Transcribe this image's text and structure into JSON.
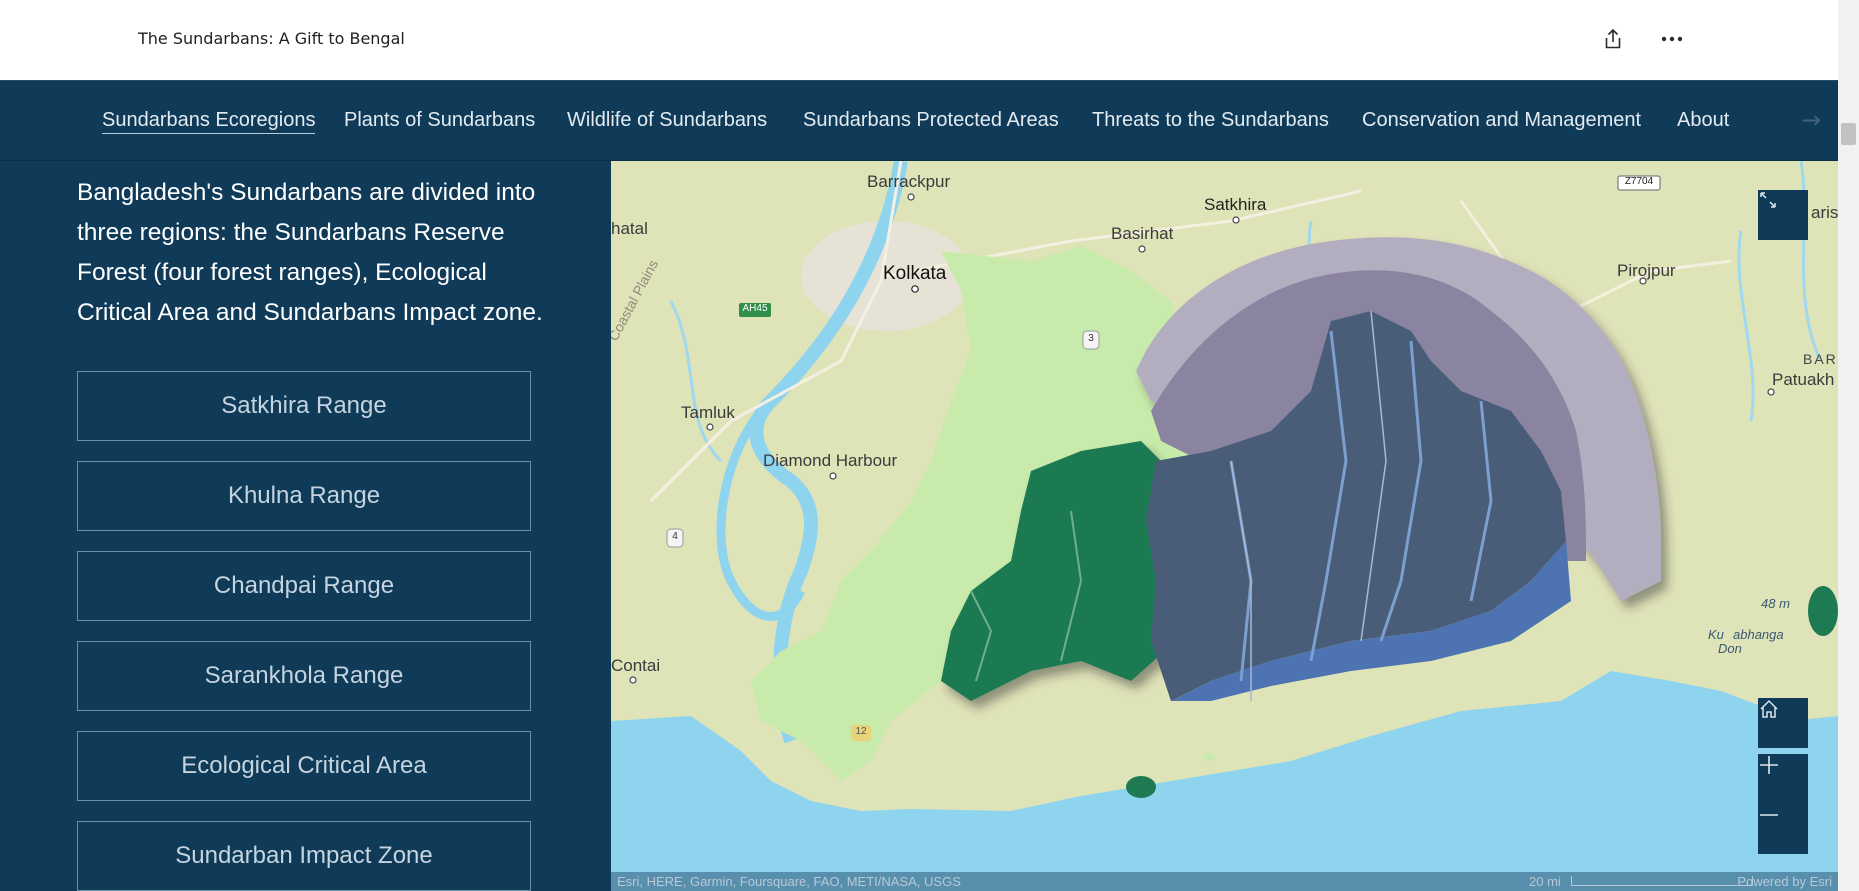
{
  "header": {
    "title": "The Sundarbans: A Gift to Bengal",
    "share_icon": "share-icon",
    "more_icon": "more-icon"
  },
  "nav": {
    "items": [
      {
        "label": "Sundarbans Ecoregions",
        "active": true
      },
      {
        "label": "Plants of Sundarbans"
      },
      {
        "label": "Wildlife of Sundarbans"
      },
      {
        "label": "Sundarbans Protected Areas"
      },
      {
        "label": "Threats to the Sundarbans"
      },
      {
        "label": "Conservation and Management"
      },
      {
        "label": "About"
      }
    ],
    "next_arrow": "→"
  },
  "panel": {
    "intro": "Bangladesh's Sundarbans are divided into three regions: the Sundarbans Reserve Forest (four forest ranges), Ecological Critical Area and Sundarbans Impact zone.",
    "buttons": [
      "Satkhira Range",
      "Khulna Range",
      "Chandpai Range",
      "Sarankhola Range",
      "Ecological Critical Area",
      "Sundarban Impact Zone"
    ]
  },
  "map": {
    "labels": {
      "barrackpur": "Barrackpur",
      "satkhira": "Satkhira",
      "basirhat": "Basirhat",
      "kolkata": "Kolkata",
      "bhatal": "hatal",
      "coastal_plains": "Coastal Plains",
      "tamluk": "Tamluk",
      "diamond_harbour": "Diamond Harbour",
      "contai": "Contai",
      "pirojpur": "Pirojpur",
      "barisal": "aris",
      "bar": "BAR",
      "patuakhali": "Patuakh",
      "kuakata": "Ku",
      "kuakata2": "abhanga",
      "kuakata3": "Don",
      "elevation": "48 m"
    },
    "shields": {
      "z7704": "Z7704",
      "ah45": "AH45",
      "r3": "3",
      "r4": "4",
      "r12": "12"
    },
    "attribution": "Esri, HERE, Garmin, Foursquare, FAO, METI/NASA, USGS",
    "scale": "20 mi",
    "powered_by": "Powered by Esri",
    "controls": {
      "expand_icon": "expand-icon",
      "home_icon": "home-icon",
      "zoom_in_icon": "zoom-in-icon",
      "zoom_out_icon": "zoom-out-icon"
    },
    "colors": {
      "land": "#dfe3b8",
      "water": "#8fd4ee",
      "urban": "#e6e3d6",
      "india_forest": "#c8ebac",
      "india_reserve": "#1e7a52",
      "bd_forest": "#4a5d78",
      "impact_zone": "#b3adc0",
      "eca": "#8b84a0",
      "sea_forest": "#4e73b3"
    }
  }
}
